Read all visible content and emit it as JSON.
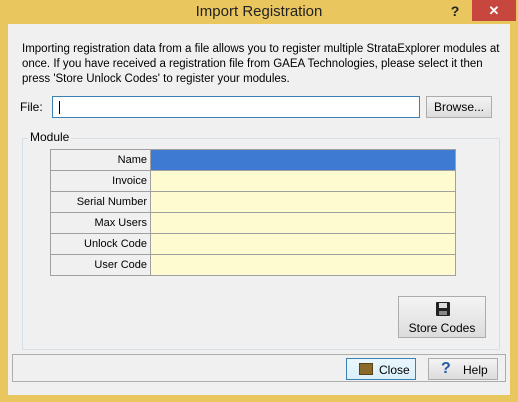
{
  "window": {
    "title": "Import Registration",
    "help_glyph": "?",
    "close_glyph": "✕"
  },
  "description": "Importing registration data from a file allows you to register multiple StrataExplorer modules at once. If you have received a registration file from GAEA Technologies, please select it then press 'Store Unlock Codes' to register your modules.",
  "file": {
    "label": "File:",
    "value": "",
    "browse_label": "Browse..."
  },
  "module": {
    "group_label": "Module",
    "rows": [
      {
        "label": "Name",
        "value": ""
      },
      {
        "label": "Invoice",
        "value": ""
      },
      {
        "label": "Serial Number",
        "value": ""
      },
      {
        "label": "Max Users",
        "value": ""
      },
      {
        "label": "Unlock Code",
        "value": ""
      },
      {
        "label": "User Code",
        "value": ""
      }
    ],
    "selected_row": "Name",
    "store_label": "Store Codes",
    "store_icon": "floppy-disk-icon"
  },
  "footer": {
    "close_label": "Close",
    "close_icon": "door-icon",
    "help_label": "Help",
    "help_icon": "question-icon"
  },
  "colors": {
    "title_bar": "#eac65f",
    "close_button": "#c7463d",
    "grid_value": "#fffbd1",
    "selection": "#3e7ad1"
  }
}
